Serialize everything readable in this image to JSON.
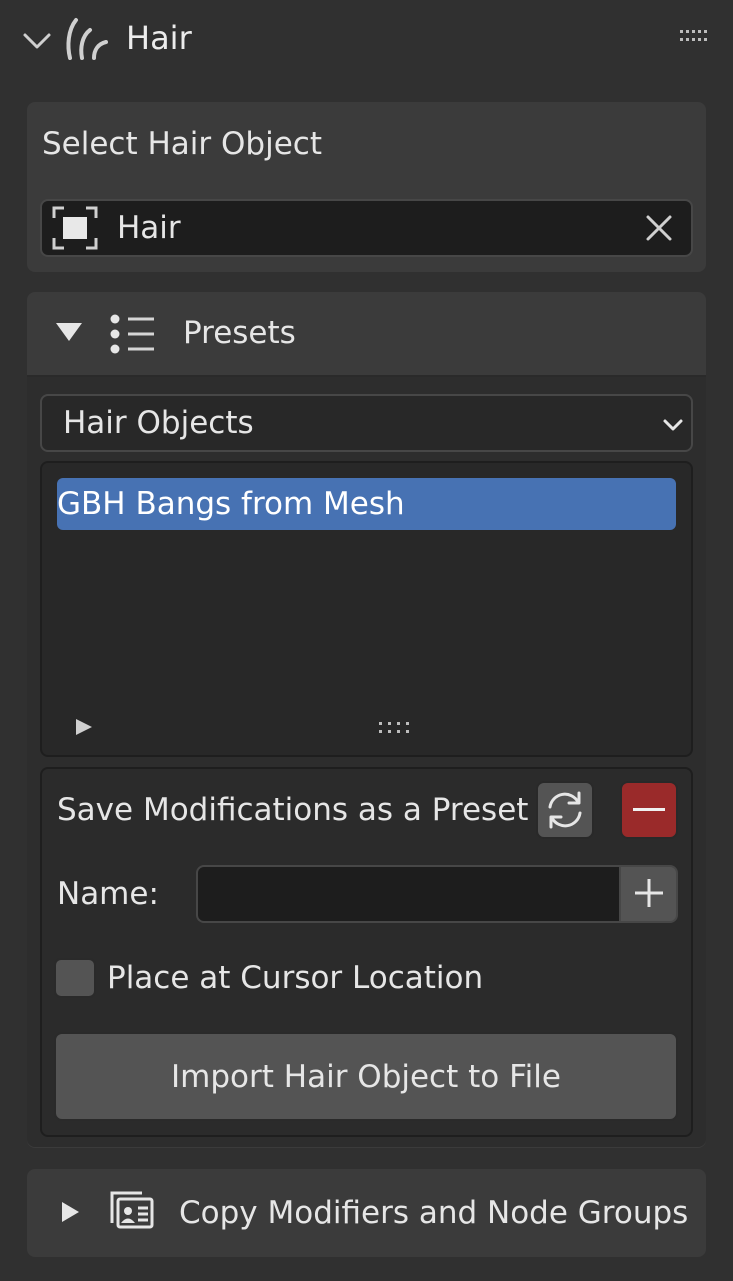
{
  "panel": {
    "title": "Hair",
    "icons": {
      "collapse": "chevron-down-icon",
      "hair": "hair-curves-icon",
      "drag": "drag-grip-icon"
    }
  },
  "select_hair": {
    "label": "Select Hair Object",
    "field_value": "Hair",
    "field_icon": "object-icon",
    "clear_icon": "close-icon"
  },
  "presets": {
    "title": "Presets",
    "dropdown_value": "Hair Objects",
    "items": [
      "GBH Bangs from Mesh"
    ],
    "selected_index": 0
  },
  "save": {
    "label": "Save Modifications as a Preset",
    "name_label": "Name:",
    "name_value": "",
    "checkbox_label": "Place at Cursor Location",
    "checkbox_checked": false,
    "import_button": "Import Hair Object to File"
  },
  "copy_modifiers": {
    "title": "Copy Modifiers and Node Groups"
  },
  "colors": {
    "background": "#303030",
    "panel": "#3b3b3b",
    "selection": "#4772b3",
    "remove": "#9a2a2a"
  }
}
